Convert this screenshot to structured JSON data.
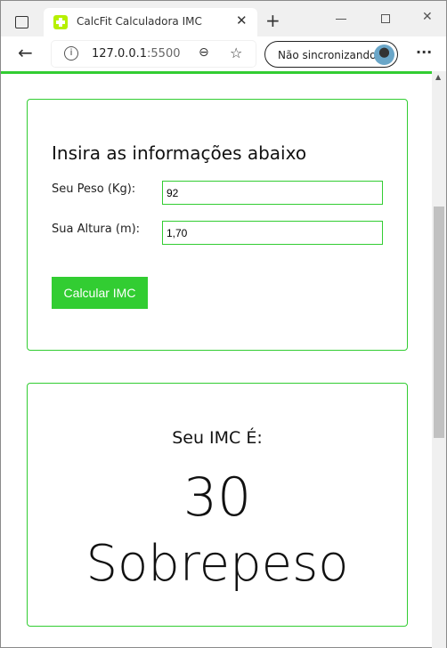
{
  "browser": {
    "tab_title": "CalcFit Calculadora IMC",
    "url_host": "127.0.0.1",
    "url_port": ":5500",
    "sync_label": "Não sincronizando",
    "accent": "#32cd32"
  },
  "form": {
    "heading": "Insira as informações abaixo",
    "weight_label": "Seu Peso (Kg):",
    "weight_value": "92",
    "height_label": "Sua Altura (m):",
    "height_value": "1,70",
    "submit_label": "Calcular IMC"
  },
  "result": {
    "heading": "Seu IMC É:",
    "value": "30",
    "category": "Sobrepeso"
  }
}
